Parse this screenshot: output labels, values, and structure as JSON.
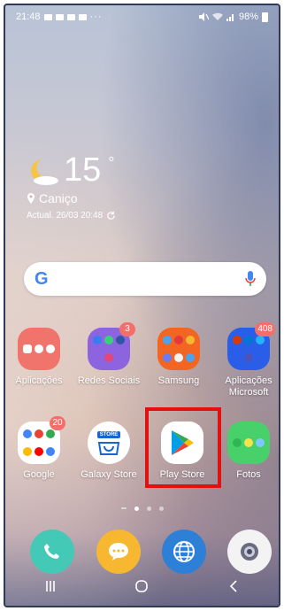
{
  "status_bar": {
    "time": "21:48",
    "more": "···",
    "battery": "98%"
  },
  "weather": {
    "temperature": "15",
    "degree": "°",
    "location": "Caniço",
    "updated": "Actual. 26/03 20:48"
  },
  "search": {
    "logo": "G"
  },
  "apps": [
    {
      "label": "Aplicações",
      "badge": ""
    },
    {
      "label": "Redes Sociais",
      "badge": "3"
    },
    {
      "label": "Samsung",
      "badge": ""
    },
    {
      "label": "Aplicações Microsoft",
      "badge": "408"
    },
    {
      "label": "Google",
      "badge": "20"
    },
    {
      "label": "Galaxy Store",
      "badge": ""
    },
    {
      "label": "Play Store",
      "badge": ""
    },
    {
      "label": "Fotos",
      "badge": ""
    }
  ],
  "galaxy_store_icon_text": "STORE",
  "colors": {
    "highlight": "#e31010",
    "badge": "#f36f6a"
  }
}
